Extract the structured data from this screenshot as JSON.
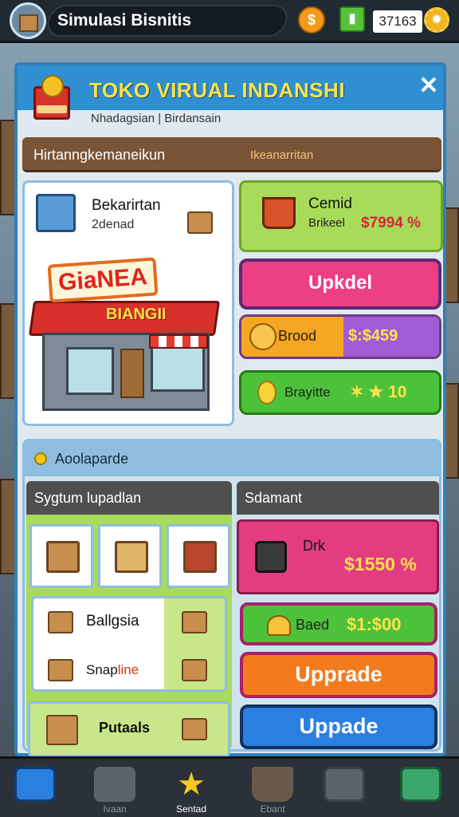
{
  "topbar": {
    "title": "Simulasi Bisnitis",
    "coin_symbol": "$",
    "currency_amount": "37163",
    "colors": {
      "coin": "#f39a1c",
      "gem": "#58c13a",
      "gear": "#f2b31c"
    }
  },
  "panel": {
    "title": "TOKO VIRUAL INDANSHI",
    "icon_label": "",
    "close_label": "✕",
    "breadcrumb": "Nhadagsian | Birdansain",
    "section_left": "Hirtanngkemaneikun",
    "section_right": "Ikeanarritan"
  },
  "store": {
    "title": "Bekarirtan",
    "subtitle": "2denad",
    "sign": "GiaNEA",
    "sign_sub": "BIANGII"
  },
  "price_card": {
    "name": "Cemid",
    "sub": "Brikeel",
    "value": "$7994 %"
  },
  "buttons": {
    "pink": "Upkdel",
    "split_left": "Brood",
    "split_right": "$:$459",
    "green_left": "Brayitte",
    "green_right": "✶ ★ 10"
  },
  "lower": {
    "heading": "Aoolaparde",
    "left_header": "Sygtum lupadlan",
    "row1": "Ballgsia",
    "row2_prefix": "Snap",
    "row2_accent": "line",
    "bottom": "Putaals",
    "right_header": "Sdamant",
    "magenta_label": "Drk",
    "magenta_value": "$1550 %",
    "green_btn_left": "Baed",
    "green_btn_right": "$1:$00",
    "orange_btn": "Upprade",
    "blue_btn": "Uppade"
  },
  "nav": {
    "items": [
      {
        "label": "",
        "icon": "home-icon"
      },
      {
        "label": "Ivaan",
        "icon": "tag-icon"
      },
      {
        "label": "Sentad",
        "icon": "star-icon"
      },
      {
        "label": "Ebant",
        "icon": "bucket-icon"
      },
      {
        "label": "",
        "icon": "profile-icon"
      },
      {
        "label": "",
        "icon": "download-icon"
      }
    ]
  }
}
